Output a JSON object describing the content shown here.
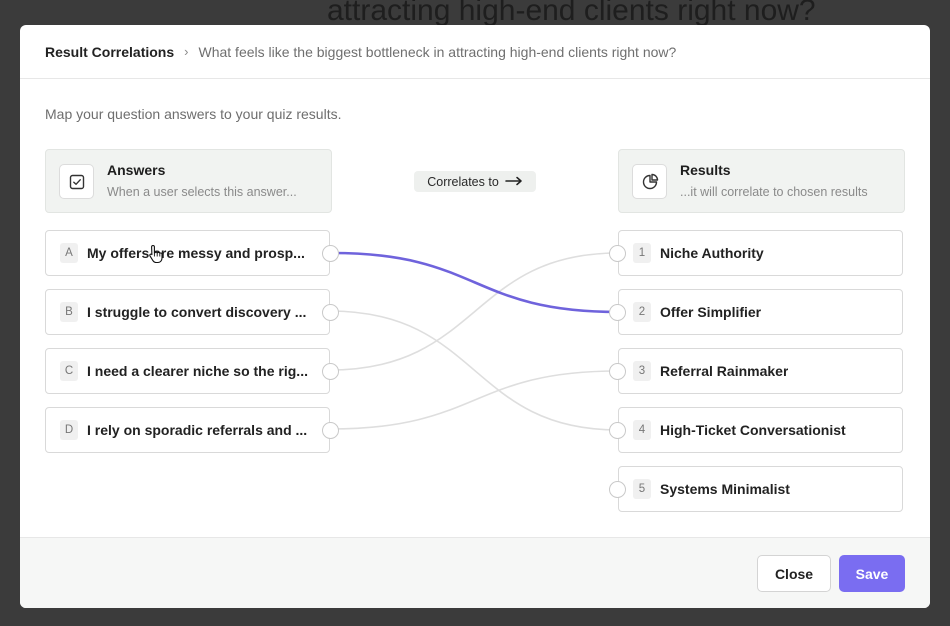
{
  "background": {
    "heading": "attracting high-end clients right now?"
  },
  "breadcrumb": {
    "root": "Result Correlations",
    "separator": "›",
    "current": "What feels like the biggest bottleneck in attracting high-end clients right now?"
  },
  "subtitle": "Map your question answers to your quiz results.",
  "answers_header": {
    "title": "Answers",
    "description": "When a user selects this answer...",
    "icon": "checkbox-icon"
  },
  "results_header": {
    "title": "Results",
    "description": "...it will correlate to chosen results",
    "icon": "chart-pie-icon"
  },
  "correlates_label": "Correlates to",
  "answers": [
    {
      "key": "A",
      "text": "My offers are messy and prosp..."
    },
    {
      "key": "B",
      "text": "I struggle to convert discovery ..."
    },
    {
      "key": "C",
      "text": "I need a clearer niche so the rig..."
    },
    {
      "key": "D",
      "text": "I rely on sporadic referrals and ..."
    }
  ],
  "results": [
    {
      "key": "1",
      "text": "Niche Authority"
    },
    {
      "key": "2",
      "text": "Offer Simplifier"
    },
    {
      "key": "3",
      "text": "Referral Rainmaker"
    },
    {
      "key": "4",
      "text": "High-Ticket Conversationist"
    },
    {
      "key": "5",
      "text": "Systems Minimalist"
    }
  ],
  "correlations": [
    {
      "answer": "A",
      "result": "2",
      "highlighted": true
    },
    {
      "answer": "B",
      "result": "4",
      "highlighted": false
    },
    {
      "answer": "C",
      "result": "1",
      "highlighted": false
    },
    {
      "answer": "D",
      "result": "3",
      "highlighted": false
    }
  ],
  "footer": {
    "close_label": "Close",
    "save_label": "Save"
  },
  "colors": {
    "accent": "#7a6df1",
    "link_idle": "#dedede",
    "link_active": "#6f63dc",
    "overlay": "#3b3b3b"
  }
}
